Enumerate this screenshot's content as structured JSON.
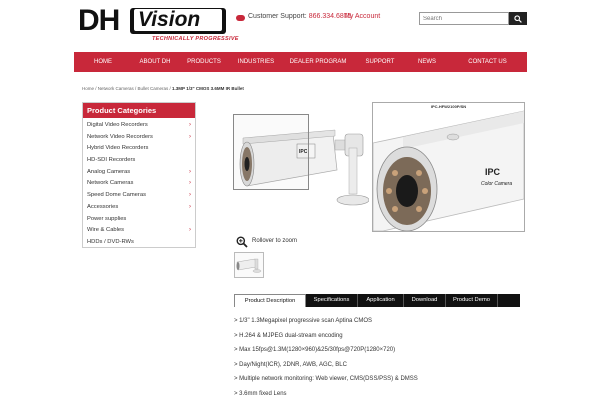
{
  "header": {
    "logo_dh": "DH",
    "logo_vision": "Vision",
    "logo_tagline": "TECHNICALLY PROGRESSIVE",
    "support_label": "Customer Support:",
    "support_phone": "866.334.6875",
    "my_account": "My Account",
    "search_placeholder": "Search"
  },
  "nav": {
    "items": [
      {
        "label": "HOME",
        "w": 0
      },
      {
        "label": "ABOUT DH"
      },
      {
        "label": "PRODUCTS"
      },
      {
        "label": "INDUSTRIES"
      },
      {
        "label": "DEALER PROGRAM"
      },
      {
        "label": "SUPPORT"
      },
      {
        "label": "NEWS"
      },
      {
        "label": "CONTACT US"
      }
    ]
  },
  "breadcrumb": {
    "path": "Home / Network Cameras / Bullet Cameras / ",
    "current": "1.3MP 1/3\" CMOS 3.6MM IR Bullet"
  },
  "sidebar": {
    "title": "Product Categories",
    "items": [
      {
        "label": "Digital Video Recorders",
        "chevron": true
      },
      {
        "label": "Network Video Recorders",
        "chevron": true
      },
      {
        "label": "Hybrid Video Recorders",
        "chevron": false
      },
      {
        "label": "HD-SDI Recorders",
        "chevron": false
      },
      {
        "label": "Analog Cameras",
        "chevron": true
      },
      {
        "label": "Network Cameras",
        "chevron": true
      },
      {
        "label": "Speed Dome Cameras",
        "chevron": true
      },
      {
        "label": "Accessories",
        "chevron": true
      },
      {
        "label": "Power supplies",
        "chevron": false
      },
      {
        "label": "Wire & Cables",
        "chevron": true
      },
      {
        "label": "HDDs / DVD-RWs",
        "chevron": false
      }
    ],
    "chevron_glyph": "›"
  },
  "product": {
    "zoom_label": "IPC-HFW2100P/SN",
    "rollover": "Rollover to zoom",
    "camera_brand_text": "IPC",
    "camera_sub_text": "Color Camera"
  },
  "tabs": [
    {
      "label": "Product Description",
      "active": true
    },
    {
      "label": "Specifications",
      "active": false
    },
    {
      "label": "Application",
      "active": false
    },
    {
      "label": "Download",
      "active": false
    },
    {
      "label": "Product Demo",
      "active": false
    }
  ],
  "features": [
    "> 1/3\" 1.3Megapixel progressive scan Aptina CMOS",
    "> H.264 & MJPEG dual-stream encoding",
    "> Max 15fps@1.3M(1280×960)&25/30fps@720P(1280×720)",
    "> Day/Night(ICR), 2DNR, AWB, AGC, BLC",
    "> Multiple network monitoring: Web viewer, CMS(DSS/PSS) & DMSS",
    "> 3.6mm fixed Lens"
  ],
  "colors": {
    "brand_red": "#c8283a",
    "dark": "#111111"
  }
}
